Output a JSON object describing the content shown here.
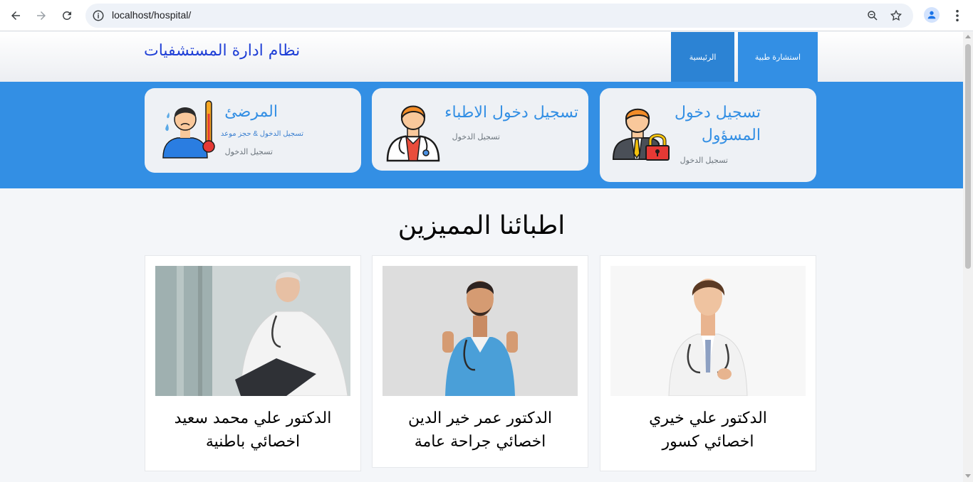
{
  "browser": {
    "url": "localhost/hospital/",
    "back_icon": "arrow-left-icon",
    "forward_icon": "arrow-right-icon",
    "reload_icon": "reload-icon",
    "info_icon": "info-icon",
    "zoom_icon": "zoom-icon",
    "bookmark_icon": "star-icon",
    "profile_icon": "person-icon",
    "menu_icon": "kebab-menu-icon"
  },
  "header": {
    "brand": "نظام ادارة المستشفيات",
    "nav": [
      {
        "label": "الرئيسية",
        "active": true
      },
      {
        "label": "استشارة طبية",
        "active": false
      }
    ],
    "accent_color": "#338fe4",
    "brand_color": "#1f3fd6"
  },
  "login_cards": [
    {
      "title": "تسجيل دخول المسؤول",
      "link": "تسجيل الدخول",
      "icon": "admin-lock-icon"
    },
    {
      "title": "تسجيل دخول الاطباء",
      "link": "تسجيل الدخول",
      "icon": "doctor-icon"
    },
    {
      "title": "المرضئ",
      "subtitle": "تسجيل الدخول & حجز موعد",
      "link": "تسجيل الدخول",
      "icon": "sick-patient-icon"
    }
  ],
  "doctors_section": {
    "title": "اطبائنا المميزين",
    "doctors": [
      {
        "name": "الدكتور علي خيري",
        "specialty": "اخصائي كسور"
      },
      {
        "name": "الدكتور عمر خير الدين",
        "specialty": "اخصائي جراحة عامة"
      },
      {
        "name": "الدكتور علي محمد سعيد",
        "specialty": "اخصائي باطنية"
      }
    ]
  }
}
